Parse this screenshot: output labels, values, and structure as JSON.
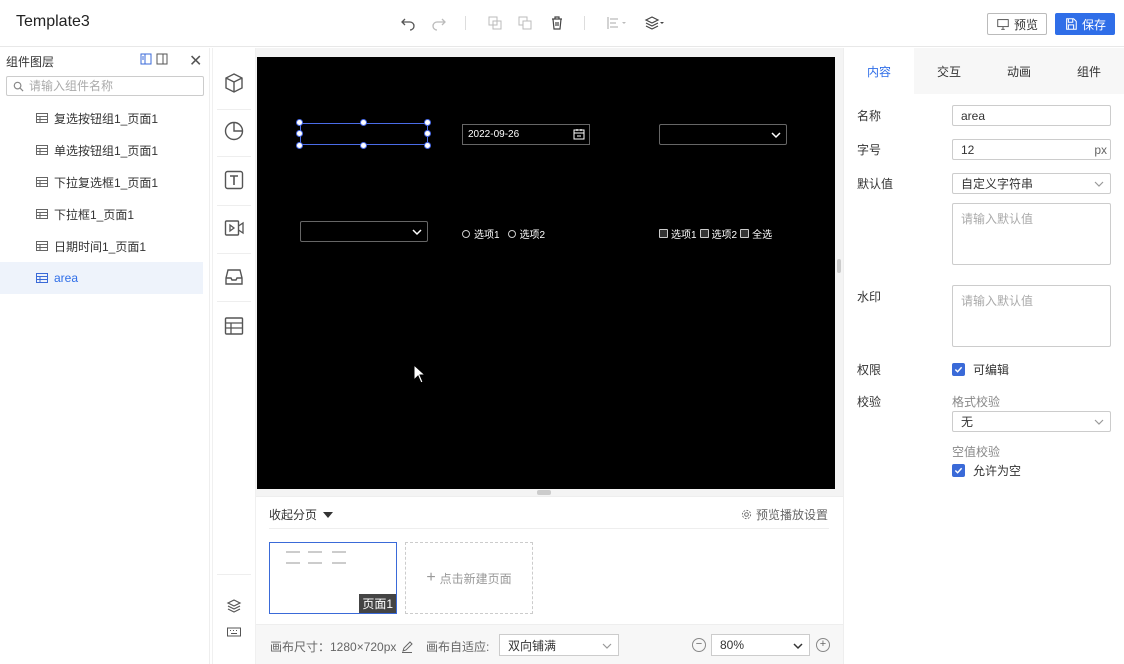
{
  "app": {
    "title": "Template3"
  },
  "toolbar": {
    "undo_icon": "undo-icon",
    "redo_icon": "redo-icon",
    "copy_icon": "copy-icon",
    "paste_icon": "paste-icon",
    "delete_icon": "trash-icon",
    "align_icon": "align-icon",
    "layer_icon": "layers-icon",
    "preview_label": "预览",
    "save_label": "保存",
    "accent": "#2f6ee8"
  },
  "layers": {
    "title": "组件图层",
    "search_placeholder": "请输入组件名称",
    "items": [
      {
        "label": "复选按钮组1_页面1",
        "active": false
      },
      {
        "label": "单选按钮组1_页面1",
        "active": false
      },
      {
        "label": "下拉复选框1_页面1",
        "active": false
      },
      {
        "label": "下拉框1_页面1",
        "active": false
      },
      {
        "label": "日期时间1_页面1",
        "active": false
      },
      {
        "label": "area",
        "active": true
      }
    ]
  },
  "tools": [
    "cube-icon",
    "pie-chart-icon",
    "text-icon",
    "video-icon",
    "inbox-icon",
    "table-icon",
    "layers-icon",
    "keyboard-icon"
  ],
  "canvas": {
    "date_value": "2022-09-26",
    "radio_options": [
      "选项1",
      "选项2"
    ],
    "checkbox_options": [
      "选项1",
      "选项2",
      "全选"
    ]
  },
  "pages": {
    "collapse_label": "收起分页",
    "settings_label": "预览播放设置",
    "thumb_label": "页面1",
    "new_page_label": "点击新建页面"
  },
  "status": {
    "canvas_size": "画布尺寸：1280×720px",
    "fit_label": "画布自适应:",
    "fit_value": "双向铺满",
    "zoom_value": "80%"
  },
  "props": {
    "tabs": [
      {
        "label": "内容",
        "active": true
      },
      {
        "label": "交互",
        "active": false
      },
      {
        "label": "动画",
        "active": false
      },
      {
        "label": "组件",
        "active": false
      }
    ],
    "name_label": "名称",
    "name_value": "area",
    "font_label": "字号",
    "font_value": "12",
    "font_unit": "px",
    "default_label": "默认值",
    "default_type": "自定义字符串",
    "default_placeholder": "请输入默认值",
    "watermark_label": "水印",
    "watermark_placeholder": "请输入默认值",
    "permission_label": "权限",
    "permission_value": "可编辑",
    "validate_label": "校验",
    "format_label": "格式校验",
    "format_value": "无",
    "empty_label": "空值校验",
    "empty_value": "允许为空"
  }
}
